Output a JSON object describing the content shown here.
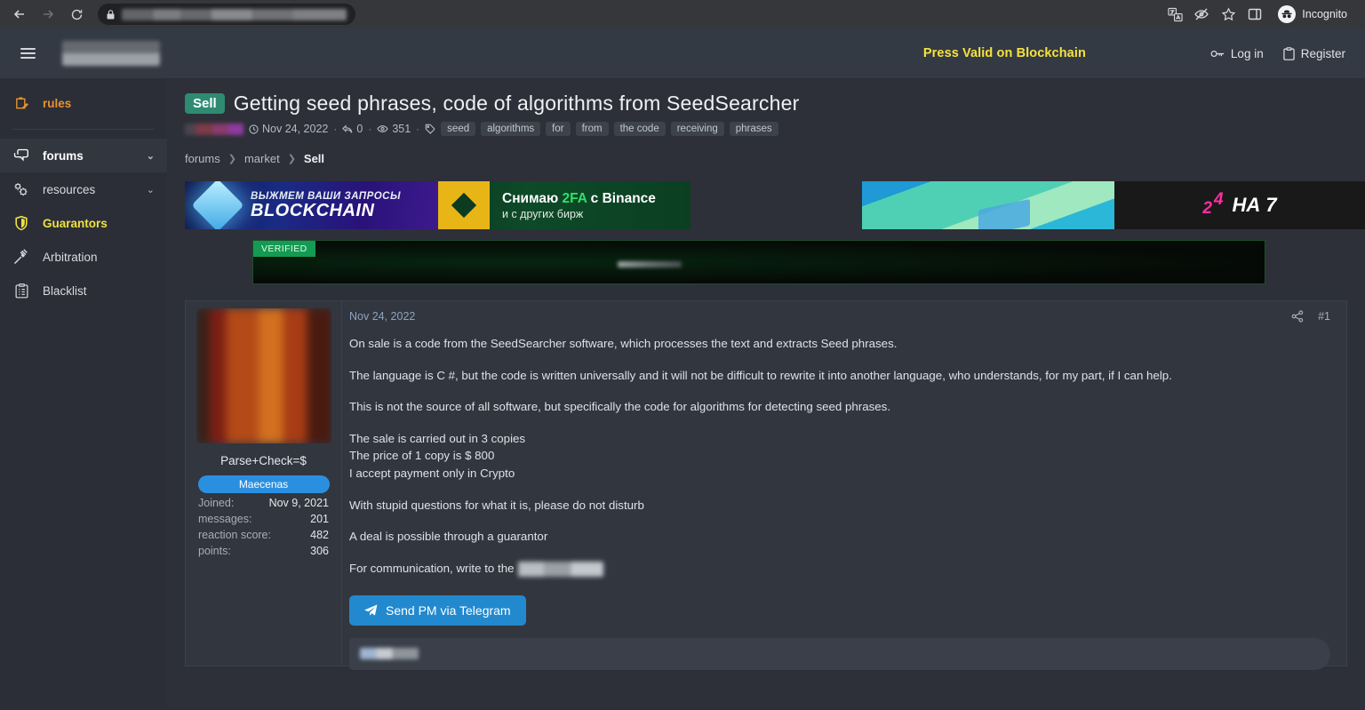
{
  "browser": {
    "back_icon": "back-arrow-icon",
    "forward_icon": "forward-arrow-icon",
    "reload_icon": "reload-icon",
    "lock_icon": "lock-icon",
    "url_placeholder": "",
    "translate_icon": "translate-icon",
    "eye_slash_icon": "eye-slash-icon",
    "star_icon": "star-icon",
    "side_panel_icon": "side-panel-icon",
    "profile_label": "Incognito"
  },
  "header": {
    "menu_icon": "hamburger-menu-icon",
    "promo": "Press Valid on Blockchain",
    "login_label": "Log in",
    "register_label": "Register",
    "promo_color": "#f5e33c"
  },
  "sidebar": {
    "items": [
      {
        "label": "rules",
        "icon": "clipboard-edit-icon",
        "accent": "#e8922e"
      },
      {
        "label": "forums",
        "icon": "comments-icon",
        "chevron": "⌄"
      },
      {
        "label": "resources",
        "icon": "gears-icon",
        "chevron": "⌄"
      },
      {
        "label": "Guarantors",
        "icon": "shield-icon",
        "accent": "#f0e040"
      },
      {
        "label": "Arbitration",
        "icon": "gavel-icon"
      },
      {
        "label": "Blacklist",
        "icon": "list-clipboard-icon"
      }
    ]
  },
  "thread": {
    "badge": "Sell",
    "badge_color": "#2e8b72",
    "title": "Getting seed phrases, code of algorithms from SeedSearcher",
    "date": "Nov 24, 2022",
    "replies": "0",
    "views": "351",
    "clock_icon": "clock-icon",
    "reply_icon": "reply-icon",
    "views_icon": "eye-icon",
    "tag_icon": "tag-icon",
    "tags": [
      "seed",
      "algorithms",
      "for",
      "from",
      "the code",
      "receiving",
      "phrases"
    ],
    "breadcrumbs": [
      {
        "label": "forums",
        "current": false
      },
      {
        "label": "market",
        "current": false
      },
      {
        "label": "Sell",
        "current": true
      }
    ]
  },
  "banners": {
    "blockchain": {
      "line1": "ВЫЖМЕМ ВАШИ ЗАПРОСЫ",
      "line2": "BLOCKCHAIN"
    },
    "binance": {
      "line1_a": "Снимаю ",
      "line1_b": "2FA",
      "line1_c": " с Binance",
      "line2": "и с других бирж"
    },
    "promo247": {
      "n2": "2",
      "n4": "4",
      "text": "НА 7"
    },
    "verified": {
      "label": "VERIFIED"
    }
  },
  "post": {
    "date": "Nov 24, 2022",
    "share_icon": "share-icon",
    "number": "#1",
    "author": {
      "name": "Parse+Check=$",
      "rank": "Maecenas",
      "rank_color": "#2b8fe0",
      "stats": [
        {
          "key": "Joined:",
          "value": "Nov 9, 2021"
        },
        {
          "key": "messages:",
          "value": "201"
        },
        {
          "key": "reaction score:",
          "value": "482"
        },
        {
          "key": "points:",
          "value": "306"
        }
      ]
    },
    "paragraphs": [
      "On sale is a code from the SeedSearcher software, which processes the text and extracts Seed phrases.",
      "The language is C #, but the code is written universally and it will not be difficult to rewrite it into another language, who understands, for my part, if I can help.",
      "This is not the source of all software, but specifically the code for algorithms for detecting seed phrases."
    ],
    "price_lines": [
      "The sale is carried out in 3 copies",
      "The price of 1 copy is $ 800",
      "I accept payment only in Crypto"
    ],
    "note": "With stupid questions for what it is, please do not disturb",
    "guarantor": "A deal is possible through a guarantor",
    "contact_prefix": "For communication, write to the",
    "telegram_button": "Send PM via Telegram",
    "telegram_icon": "paper-plane-icon",
    "telegram_color": "#2289ce"
  }
}
